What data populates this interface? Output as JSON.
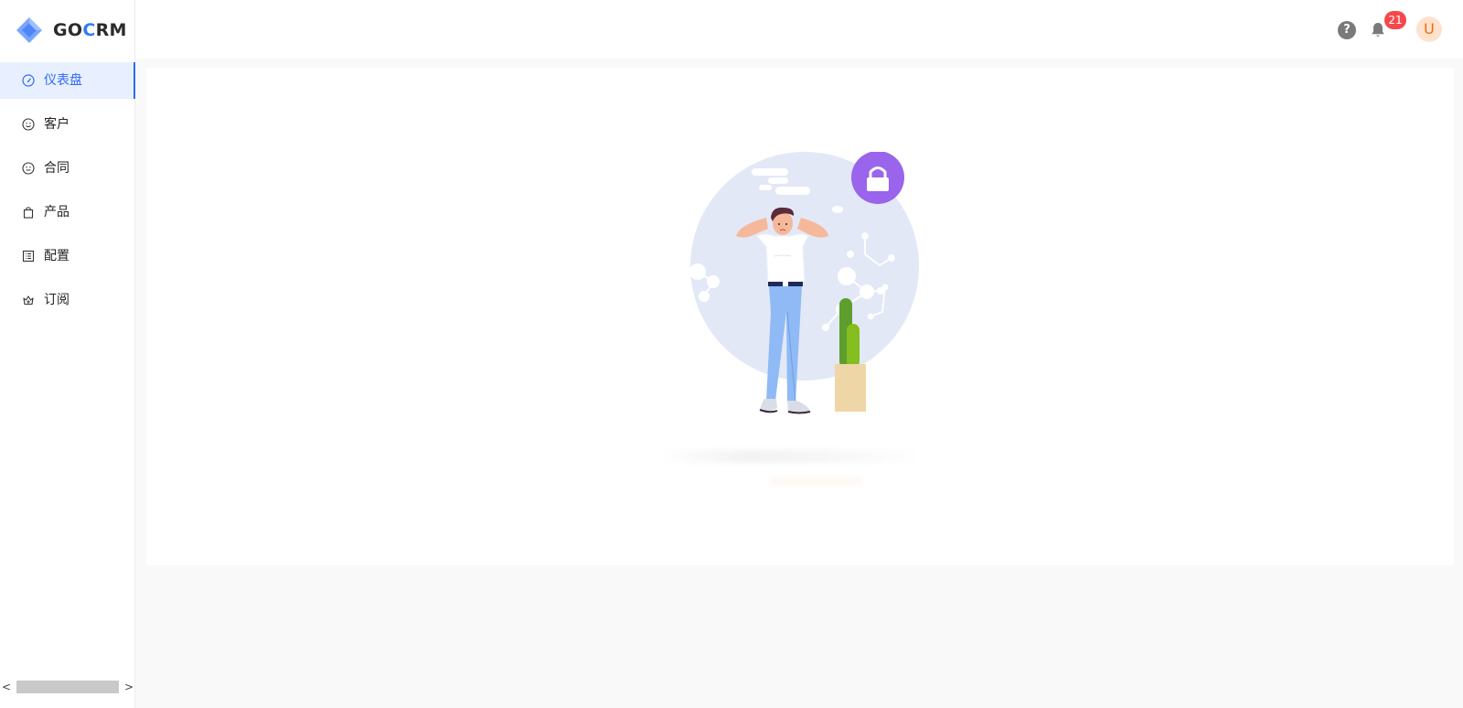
{
  "app": {
    "logo_text_prefix": "GO",
    "logo_text_accent": "C",
    "logo_text_suffix": "RM"
  },
  "sidebar": {
    "items": [
      {
        "label": "仪表盘",
        "icon": "dashboard-icon",
        "active": true
      },
      {
        "label": "客户",
        "icon": "smile-icon",
        "active": false
      },
      {
        "label": "合同",
        "icon": "meh-icon",
        "active": false
      },
      {
        "label": "产品",
        "icon": "shopping-bag-icon",
        "active": false
      },
      {
        "label": "配置",
        "icon": "profile-icon",
        "active": false
      },
      {
        "label": "订阅",
        "icon": "crown-icon",
        "active": false
      }
    ],
    "scroll_left": "<",
    "scroll_right": ">"
  },
  "header": {
    "help_symbol": "?",
    "notification_count": "21",
    "avatar_initial": "U"
  },
  "colors": {
    "primary": "#2f6bf5",
    "badge": "#f5484d",
    "lock_circle": "#9a64ec",
    "avatar_bg": "#fde3cf",
    "avatar_text": "#f56a00"
  }
}
